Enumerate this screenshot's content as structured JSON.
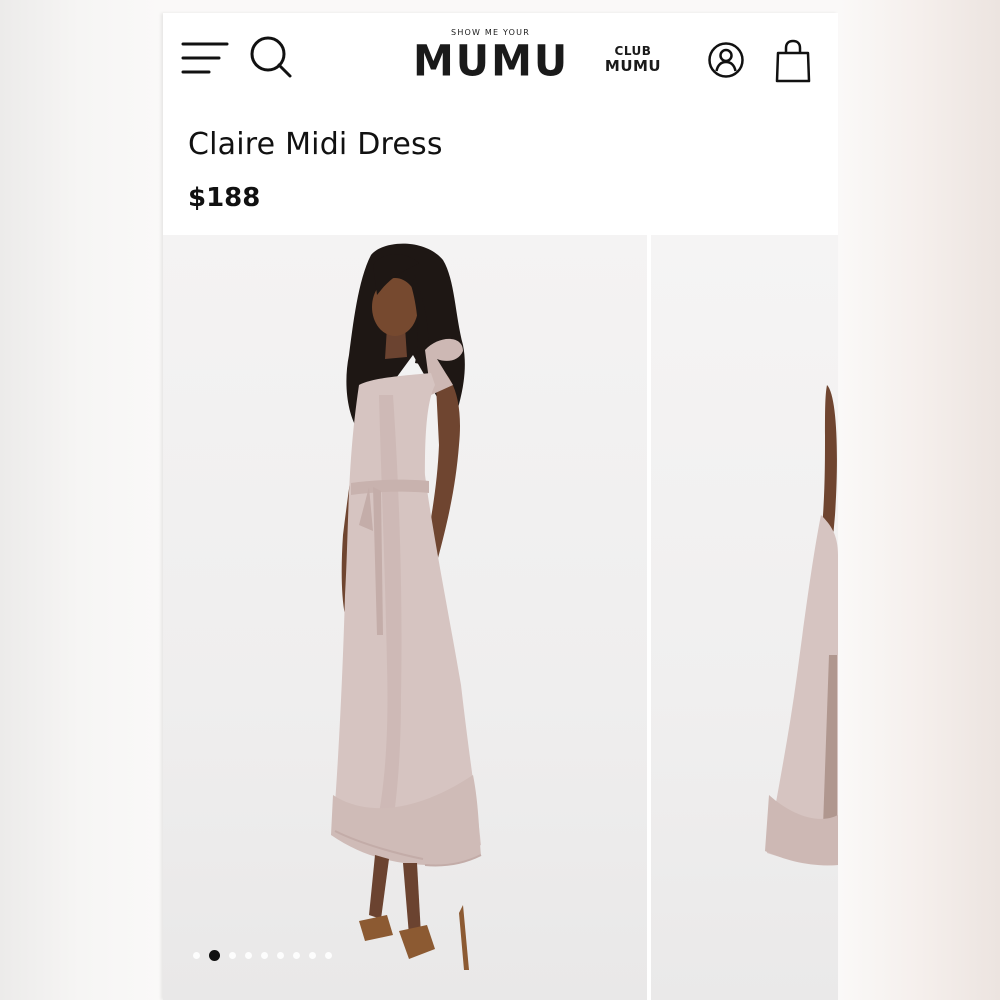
{
  "header": {
    "logo_small": "SHOW ME YOUR",
    "logo_big": "MUMU",
    "club_small": "CLUB",
    "club_big": "MUMU",
    "icons": [
      "menu-icon",
      "search-icon",
      "account-icon",
      "bag-icon"
    ]
  },
  "product": {
    "title": "Claire Midi Dress",
    "price": "$188"
  },
  "gallery": {
    "slide_count": 9,
    "active_slide": 2,
    "dress_color": "#d6c4c1"
  },
  "colors": {
    "text": "#111111",
    "dress": "#d6c4c1",
    "background": "#ffffff"
  }
}
